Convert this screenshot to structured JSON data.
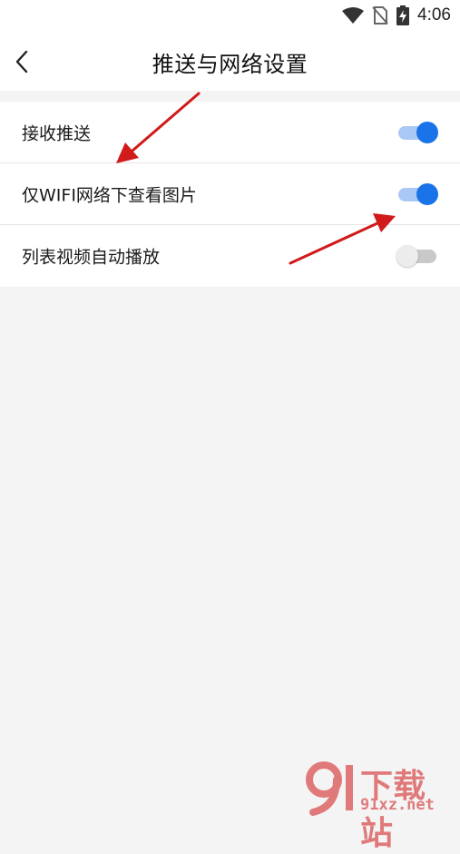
{
  "status_bar": {
    "time": "4:06"
  },
  "header": {
    "title": "推送与网络设置"
  },
  "settings": [
    {
      "label": "接收推送",
      "enabled": true
    },
    {
      "label": "仅WIFI网络下查看图片",
      "enabled": true
    },
    {
      "label": "列表视频自动播放",
      "enabled": false
    }
  ],
  "colors": {
    "switch_on": "#1a73e8",
    "switch_on_track": "#a9c8f4",
    "switch_off_track": "#c9c9c9",
    "arrow": "#d11a1a",
    "background": "#f4f4f4"
  },
  "watermark": {
    "title": "下载站",
    "url": "91xz.net"
  }
}
